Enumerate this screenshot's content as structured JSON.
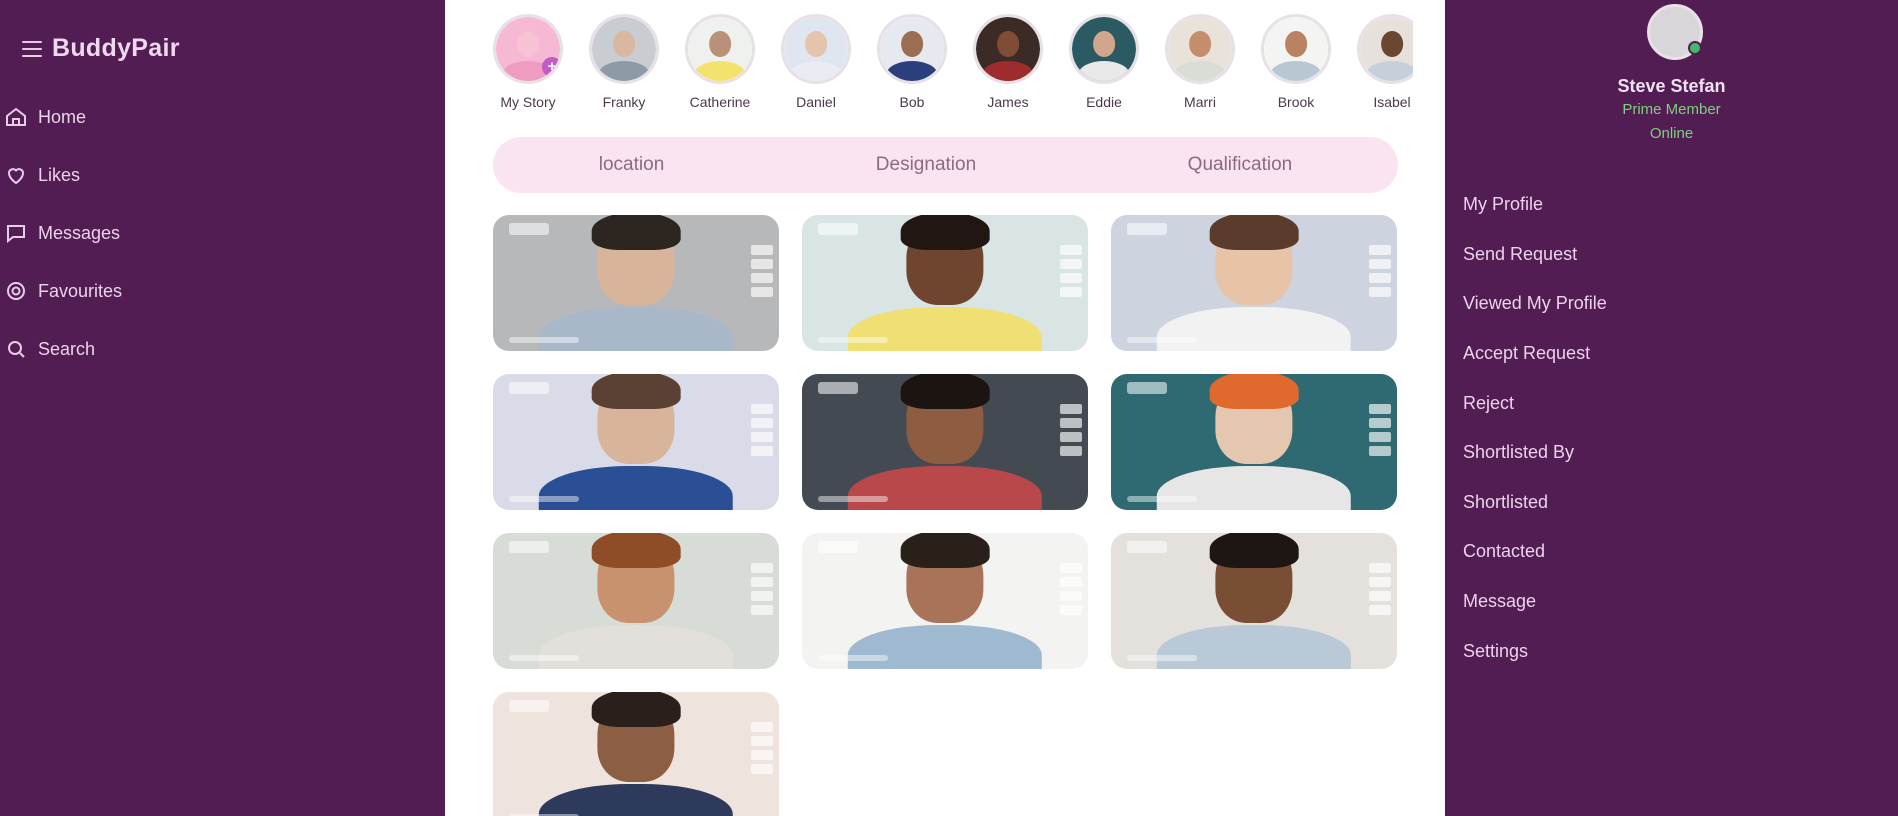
{
  "brand": {
    "name": "BuddyPair"
  },
  "nav": [
    {
      "label": "Home",
      "icon": "home-icon"
    },
    {
      "label": "Likes",
      "icon": "heart-icon"
    },
    {
      "label": "Messages",
      "icon": "chat-icon"
    },
    {
      "label": "Favourites",
      "icon": "gear-icon"
    },
    {
      "label": "Search",
      "icon": "search-icon"
    }
  ],
  "stories": [
    {
      "name": "My Story",
      "bg": "#f6b8d3",
      "skin": "#f7c3d4",
      "shirt": "#ef9cc1",
      "add": "+"
    },
    {
      "name": "Franky",
      "bg": "#c9cdd2",
      "skin": "#d8b8a0",
      "shirt": "#8f9aa8"
    },
    {
      "name": "Catherine",
      "bg": "#eef1ee",
      "skin": "#b99178",
      "shirt": "#f3e36c"
    },
    {
      "name": "Daniel",
      "bg": "#dfe6f0",
      "skin": "#e4c4ac",
      "shirt": "#e9ecf2"
    },
    {
      "name": "Bob",
      "bg": "#e7e9f1",
      "skin": "#9b6d53",
      "shirt": "#2c3f7d"
    },
    {
      "name": "James",
      "bg": "#3b2a25",
      "skin": "#7f4d36",
      "shirt": "#9f2c2c"
    },
    {
      "name": "Eddie",
      "bg": "#2b5a63",
      "skin": "#d1a68c",
      "shirt": "#e9e9e9"
    },
    {
      "name": "Marri",
      "bg": "#e8e2da",
      "skin": "#c48d6c",
      "shirt": "#d9ddd6"
    },
    {
      "name": "Brook",
      "bg": "#f4f4f2",
      "skin": "#b98262",
      "shirt": "#b9c6d4"
    },
    {
      "name": "Isabel",
      "bg": "#e6e1da",
      "skin": "#6b4630",
      "shirt": "#c6d0da"
    }
  ],
  "tabs": [
    "location",
    "Designation",
    "Qualification"
  ],
  "cards": [
    {
      "bg": "#b7b8ba",
      "hair": "#2d2520",
      "skin": "#d8b59a",
      "shirt": "#a9b8c9"
    },
    {
      "bg": "#d9e4e4",
      "hair": "#211611",
      "skin": "#6f452f",
      "shirt": "#f0df72"
    },
    {
      "bg": "#cdd3df",
      "hair": "#5a3b2c",
      "skin": "#e7c3a7",
      "shirt": "#f2f2f2"
    },
    {
      "bg": "#dadbe8",
      "hair": "#5b4133",
      "skin": "#d8b59a",
      "shirt": "#2b4f94"
    },
    {
      "bg": "#444a52",
      "hair": "#1c1410",
      "skin": "#8e5d41",
      "shirt": "#b9484a"
    },
    {
      "bg": "#2f6a73",
      "hair": "#e0692e",
      "skin": "#e5c7b0",
      "shirt": "#e6e6e6"
    },
    {
      "bg": "#d7dcd6",
      "hair": "#8e4d27",
      "skin": "#c8926f",
      "shirt": "#e3dfda"
    },
    {
      "bg": "#f3f3f1",
      "hair": "#2a201a",
      "skin": "#a9735a",
      "shirt": "#9fb9d1"
    },
    {
      "bg": "#e4e1dc",
      "hair": "#1d1613",
      "skin": "#7a4d35",
      "shirt": "#b9c9d8"
    },
    {
      "bg": "#eee3dd",
      "hair": "#2a1f1a",
      "skin": "#8c5e44",
      "shirt": "#2e3a5c"
    }
  ],
  "profile": {
    "name": "Steve Stefan",
    "label": "Prime Member",
    "status": "Online"
  },
  "menu": [
    "My Profile",
    "Send Request",
    "Viewed My Profile",
    "Accept Request",
    "Reject",
    "Shortlisted By",
    "Shortlisted",
    "Contacted",
    "Message",
    "Settings"
  ],
  "colors": {
    "sidebar": "#521d52",
    "accent": "#c35bc7",
    "tab_bar": "#fbe4f1",
    "online": "#46b86a"
  }
}
